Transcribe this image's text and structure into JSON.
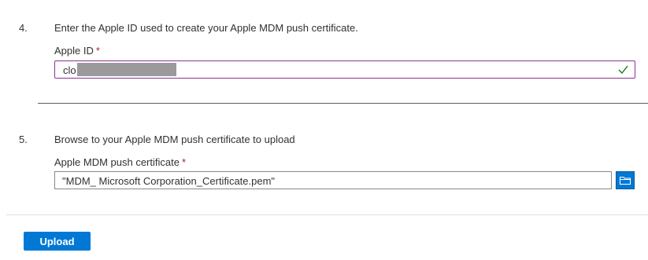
{
  "step4": {
    "number": "4.",
    "instruction": "Enter the Apple ID used to create your Apple MDM push certificate.",
    "field_label": "Apple ID",
    "required_marker": "*",
    "value_visible": "clo",
    "valid_icon": "checkmark-icon"
  },
  "step5": {
    "number": "5.",
    "instruction": "Browse to your Apple MDM push certificate to upload",
    "field_label": "Apple MDM push certificate",
    "required_marker": "*",
    "file_value": "\"MDM_ Microsoft Corporation_Certificate.pem\"",
    "browse_icon": "folder-icon"
  },
  "actions": {
    "upload_label": "Upload"
  },
  "colors": {
    "accent": "#0078d4",
    "required": "#a4262c",
    "valid": "#107c10",
    "focus_border": "#8a348e"
  }
}
